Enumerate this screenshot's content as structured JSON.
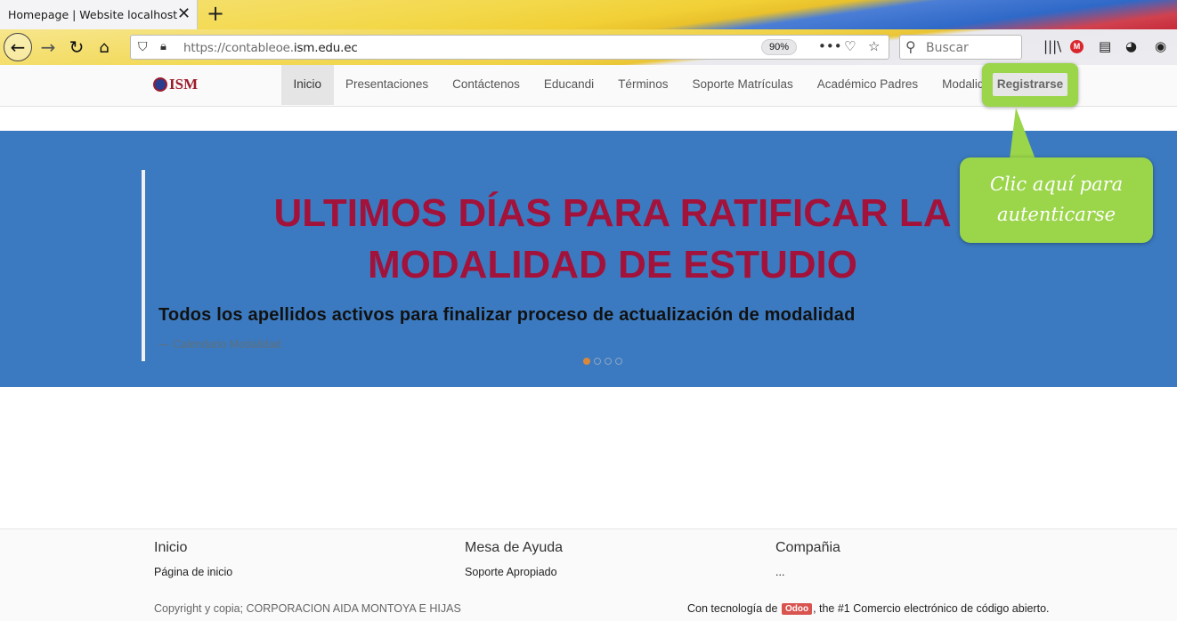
{
  "browser": {
    "tab_title": "Homepage | Website localhost",
    "url_prefix": "https://contableoe.",
    "url_domain": "ism.edu.ec",
    "zoom": "90%",
    "search_placeholder": "Buscar"
  },
  "site": {
    "logo_text": "ISM",
    "nav": [
      "Inicio",
      "Presentaciones",
      "Contáctenos",
      "Educandi",
      "Términos",
      "Soporte Matrículas",
      "Académico Padres",
      "Modalidad"
    ],
    "register_label": "Registrarse"
  },
  "banner": {
    "title_line1": "ULTIMOS DÍAS PARA RATIFICAR LA",
    "title_line2": "MODALIDAD DE ESTUDIO",
    "subtitle": "Todos los apellidos activos para finalizar proceso de actualización de modalidad",
    "source": "— Calendario Modalidad",
    "slide_count": 4,
    "active_slide": 1
  },
  "callout": {
    "line1": "Clic aquí para",
    "line2": "autenticarse"
  },
  "footer": {
    "col1_heading": "Inicio",
    "col1_link": "Página de inicio",
    "col2_heading": "Mesa de Ayuda",
    "col2_link": "Soporte Apropiado",
    "col3_heading": "Compañia",
    "col3_link": "...",
    "copyright": "Copyright y copia; CORPORACION AIDA MONTOYA E HIJAS",
    "powered_prefix": "Con tecnología de",
    "powered_badge": "Odoo",
    "powered_suffix": ", the #1 Comercio electrónico de código abierto."
  },
  "colors": {
    "banner_bg": "#3b7ac0",
    "title_red": "#a3123a",
    "callout_green": "#9ad54a"
  }
}
